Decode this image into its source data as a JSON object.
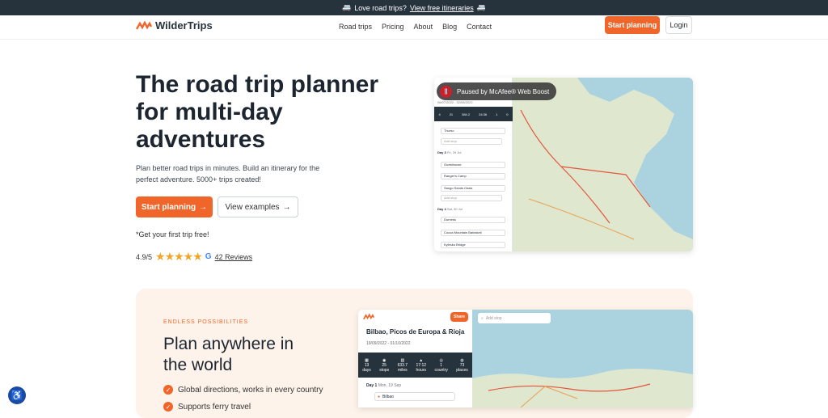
{
  "banner": {
    "prefix": "Love road trips?",
    "link": "View free itineraries"
  },
  "nav": {
    "brand": "WilderTrips",
    "links": [
      "Road trips",
      "Pricing",
      "About",
      "Blog",
      "Contact"
    ],
    "start": "Start planning",
    "login": "Login"
  },
  "hero": {
    "title": "The road trip planner for multi-day adventures",
    "subtitle": "Plan better road trips in minutes. Build an itinerary for the perfect adventure. 5000+ trips created!",
    "cta_primary": "Start planning",
    "cta_secondary": "View examples",
    "free_note": "*Get your first trip free!",
    "rating": "4.9/5",
    "reviews": "42 Reviews"
  },
  "overlay": {
    "paused": "Paused by McAfee® Web Boost"
  },
  "mock1": {
    "dates": "06/07/2022 - 02/08/2022",
    "stats": [
      "4",
      "21",
      "384.2",
      "24:36",
      "1",
      "0"
    ],
    "day2": "Day 3",
    "day2_date": "Fri, 29 Jul",
    "day3": "Day 4",
    "day3_date": "Sat, 30 Jul",
    "stops": [
      "Thurso",
      "Guesthouse",
      "Ranger's Camp",
      "Sango Sands Oasis",
      "Durness",
      "Cocoa Mountain Balnakeil",
      "Kylesku Bridge"
    ],
    "add_stop": "Add stop"
  },
  "section2": {
    "eyebrow": "ENDLESS POSSIBILITIES",
    "title": "Plan anywhere in the world",
    "features": [
      "Global directions, works in every country",
      "Supports ferry travel"
    ]
  },
  "mock2": {
    "share": "Share",
    "trip_title": "Bilbao, Picos de Europa & Rioja",
    "dates": "19/09/2022 - 01/10/2022",
    "search_placeholder": "Add stop",
    "stats": [
      {
        "v": "13",
        "l": "days"
      },
      {
        "v": "25",
        "l": "stops"
      },
      {
        "v": "633.7",
        "l": "miles"
      },
      {
        "v": "17:12",
        "l": "hours"
      },
      {
        "v": "1",
        "l": "country"
      },
      {
        "v": "73",
        "l": "places"
      }
    ],
    "day1": "Day 1",
    "day1_date": "Mon, 19 Sep",
    "stop1": "Bilbao"
  }
}
